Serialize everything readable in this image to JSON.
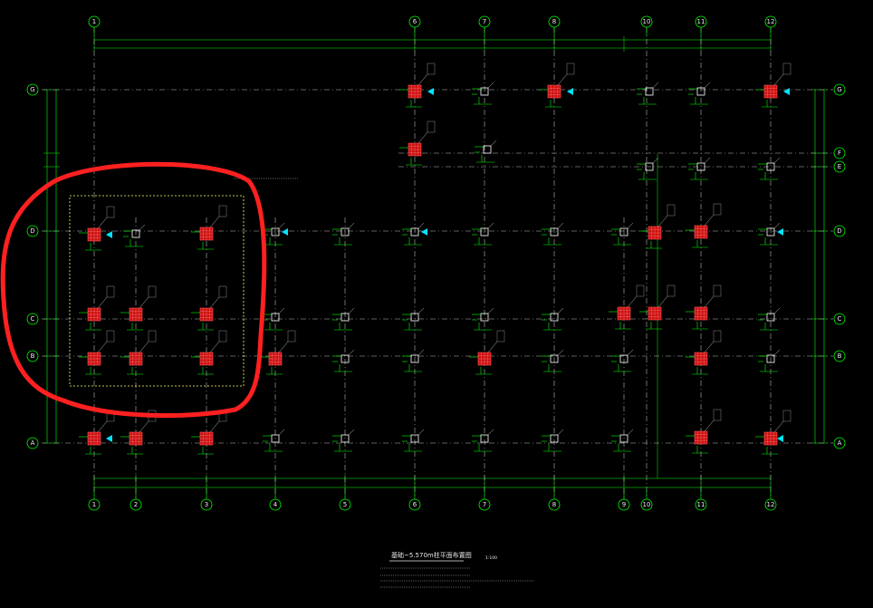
{
  "axes": {
    "vertical": [
      "1",
      "2",
      "3",
      "4",
      "5",
      "6",
      "7",
      "8",
      "9",
      "10",
      "11",
      "12"
    ],
    "horizontal": [
      "G",
      "F",
      "E",
      "D",
      "C",
      "B",
      "A"
    ]
  },
  "drawing_title": "基础~5.570m柱平面布置图",
  "scale": "1:100",
  "colors": {
    "background": "#000000",
    "grid": "#00ff00",
    "axis_dash": "#bbbbbb",
    "column_fill": "#cc1111",
    "column_outline": "#ff5555",
    "small_column": "#ffffff",
    "marker": "#00e5ff",
    "dim_line": "#00ff00",
    "highlight_box": "#ffff66",
    "annotation_circle": "#ff2020"
  }
}
